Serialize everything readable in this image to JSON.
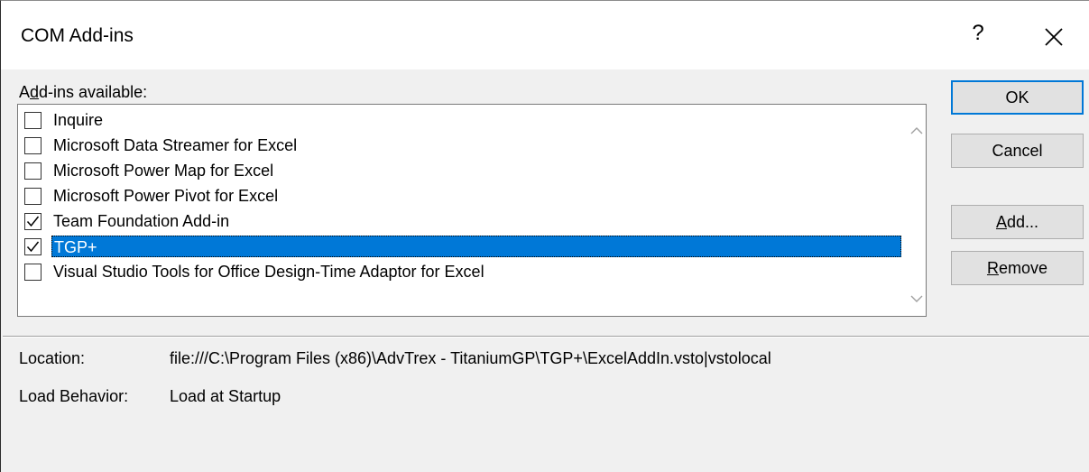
{
  "window": {
    "title": "COM Add-ins",
    "help_label": "?",
    "close_icon": "close-icon"
  },
  "addins": {
    "label_prefix": "A",
    "label_access": "d",
    "label_rest": "d-ins available:",
    "items": [
      {
        "label": "Inquire",
        "checked": false,
        "selected": false
      },
      {
        "label": "Microsoft Data Streamer for Excel",
        "checked": false,
        "selected": false
      },
      {
        "label": "Microsoft Power Map for Excel",
        "checked": false,
        "selected": false
      },
      {
        "label": "Microsoft Power Pivot for Excel",
        "checked": false,
        "selected": false
      },
      {
        "label": "Team Foundation Add-in",
        "checked": true,
        "selected": false
      },
      {
        "label": "TGP+",
        "checked": true,
        "selected": true
      },
      {
        "label": "Visual Studio Tools for Office Design-Time Adaptor for Excel",
        "checked": false,
        "selected": false
      }
    ]
  },
  "buttons": {
    "ok": "OK",
    "cancel": "Cancel",
    "add_access": "A",
    "add_rest": "dd...",
    "remove_access": "R",
    "remove_rest": "emove"
  },
  "details": {
    "location_label": "Location:",
    "location_value": "file:///C:\\Program Files (x86)\\AdvTrex - TitaniumGP\\TGP+\\ExcelAddIn.vsto|vstolocal",
    "load_behavior_label": "Load Behavior:",
    "load_behavior_value": "Load at Startup"
  },
  "colors": {
    "selection": "#0078d7",
    "dialog_bg": "#f0f0f0",
    "default_button_border": "#0078d7"
  }
}
